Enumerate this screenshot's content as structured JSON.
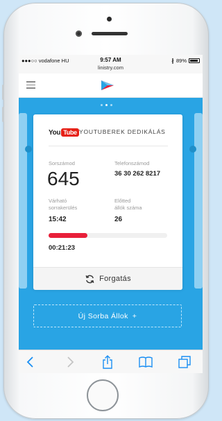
{
  "status_bar": {
    "carrier": "●●●○○ vodafone HU",
    "time": "9:57 AM",
    "url": "linistry.com",
    "bluetooth": "∦",
    "battery": "89%"
  },
  "colors": {
    "accent_blue": "#29a4e4",
    "progress_red": "#e8203a",
    "youtube_red": "#e62117"
  },
  "header": {
    "menu_icon": "hamburger-icon",
    "logo_icon": "linistry-logo"
  },
  "pager": {
    "count": 3,
    "active": 1
  },
  "ticket": {
    "youtube_logo": {
      "you": "You",
      "tube": "Tube"
    },
    "channel_name": "YOUTUBEREK DEDIKÁLÁS",
    "queue_number_label": "Sorszámod",
    "queue_number": "645",
    "phone_label": "Telefonszámod",
    "phone_number": "36 30 262 8217",
    "eta_label_line1": "Várható",
    "eta_label_line2": "sorrakerülés",
    "eta_value": "15:42",
    "ahead_label_line1": "Előtted",
    "ahead_label_line2": "állók száma",
    "ahead_value": "26",
    "progress_fraction": 0.33,
    "timer": "00:21:23",
    "rotate_label": "Forgatás",
    "rotate_icon": "refresh-icon"
  },
  "new_queue_button": {
    "label": "Új Sorba Állok",
    "icon": "+"
  },
  "toolbar": {
    "back_icon": "chevron-left-icon",
    "forward_icon": "chevron-right-icon",
    "share_icon": "share-icon",
    "bookmarks_icon": "book-icon",
    "tabs_icon": "tabs-icon"
  }
}
